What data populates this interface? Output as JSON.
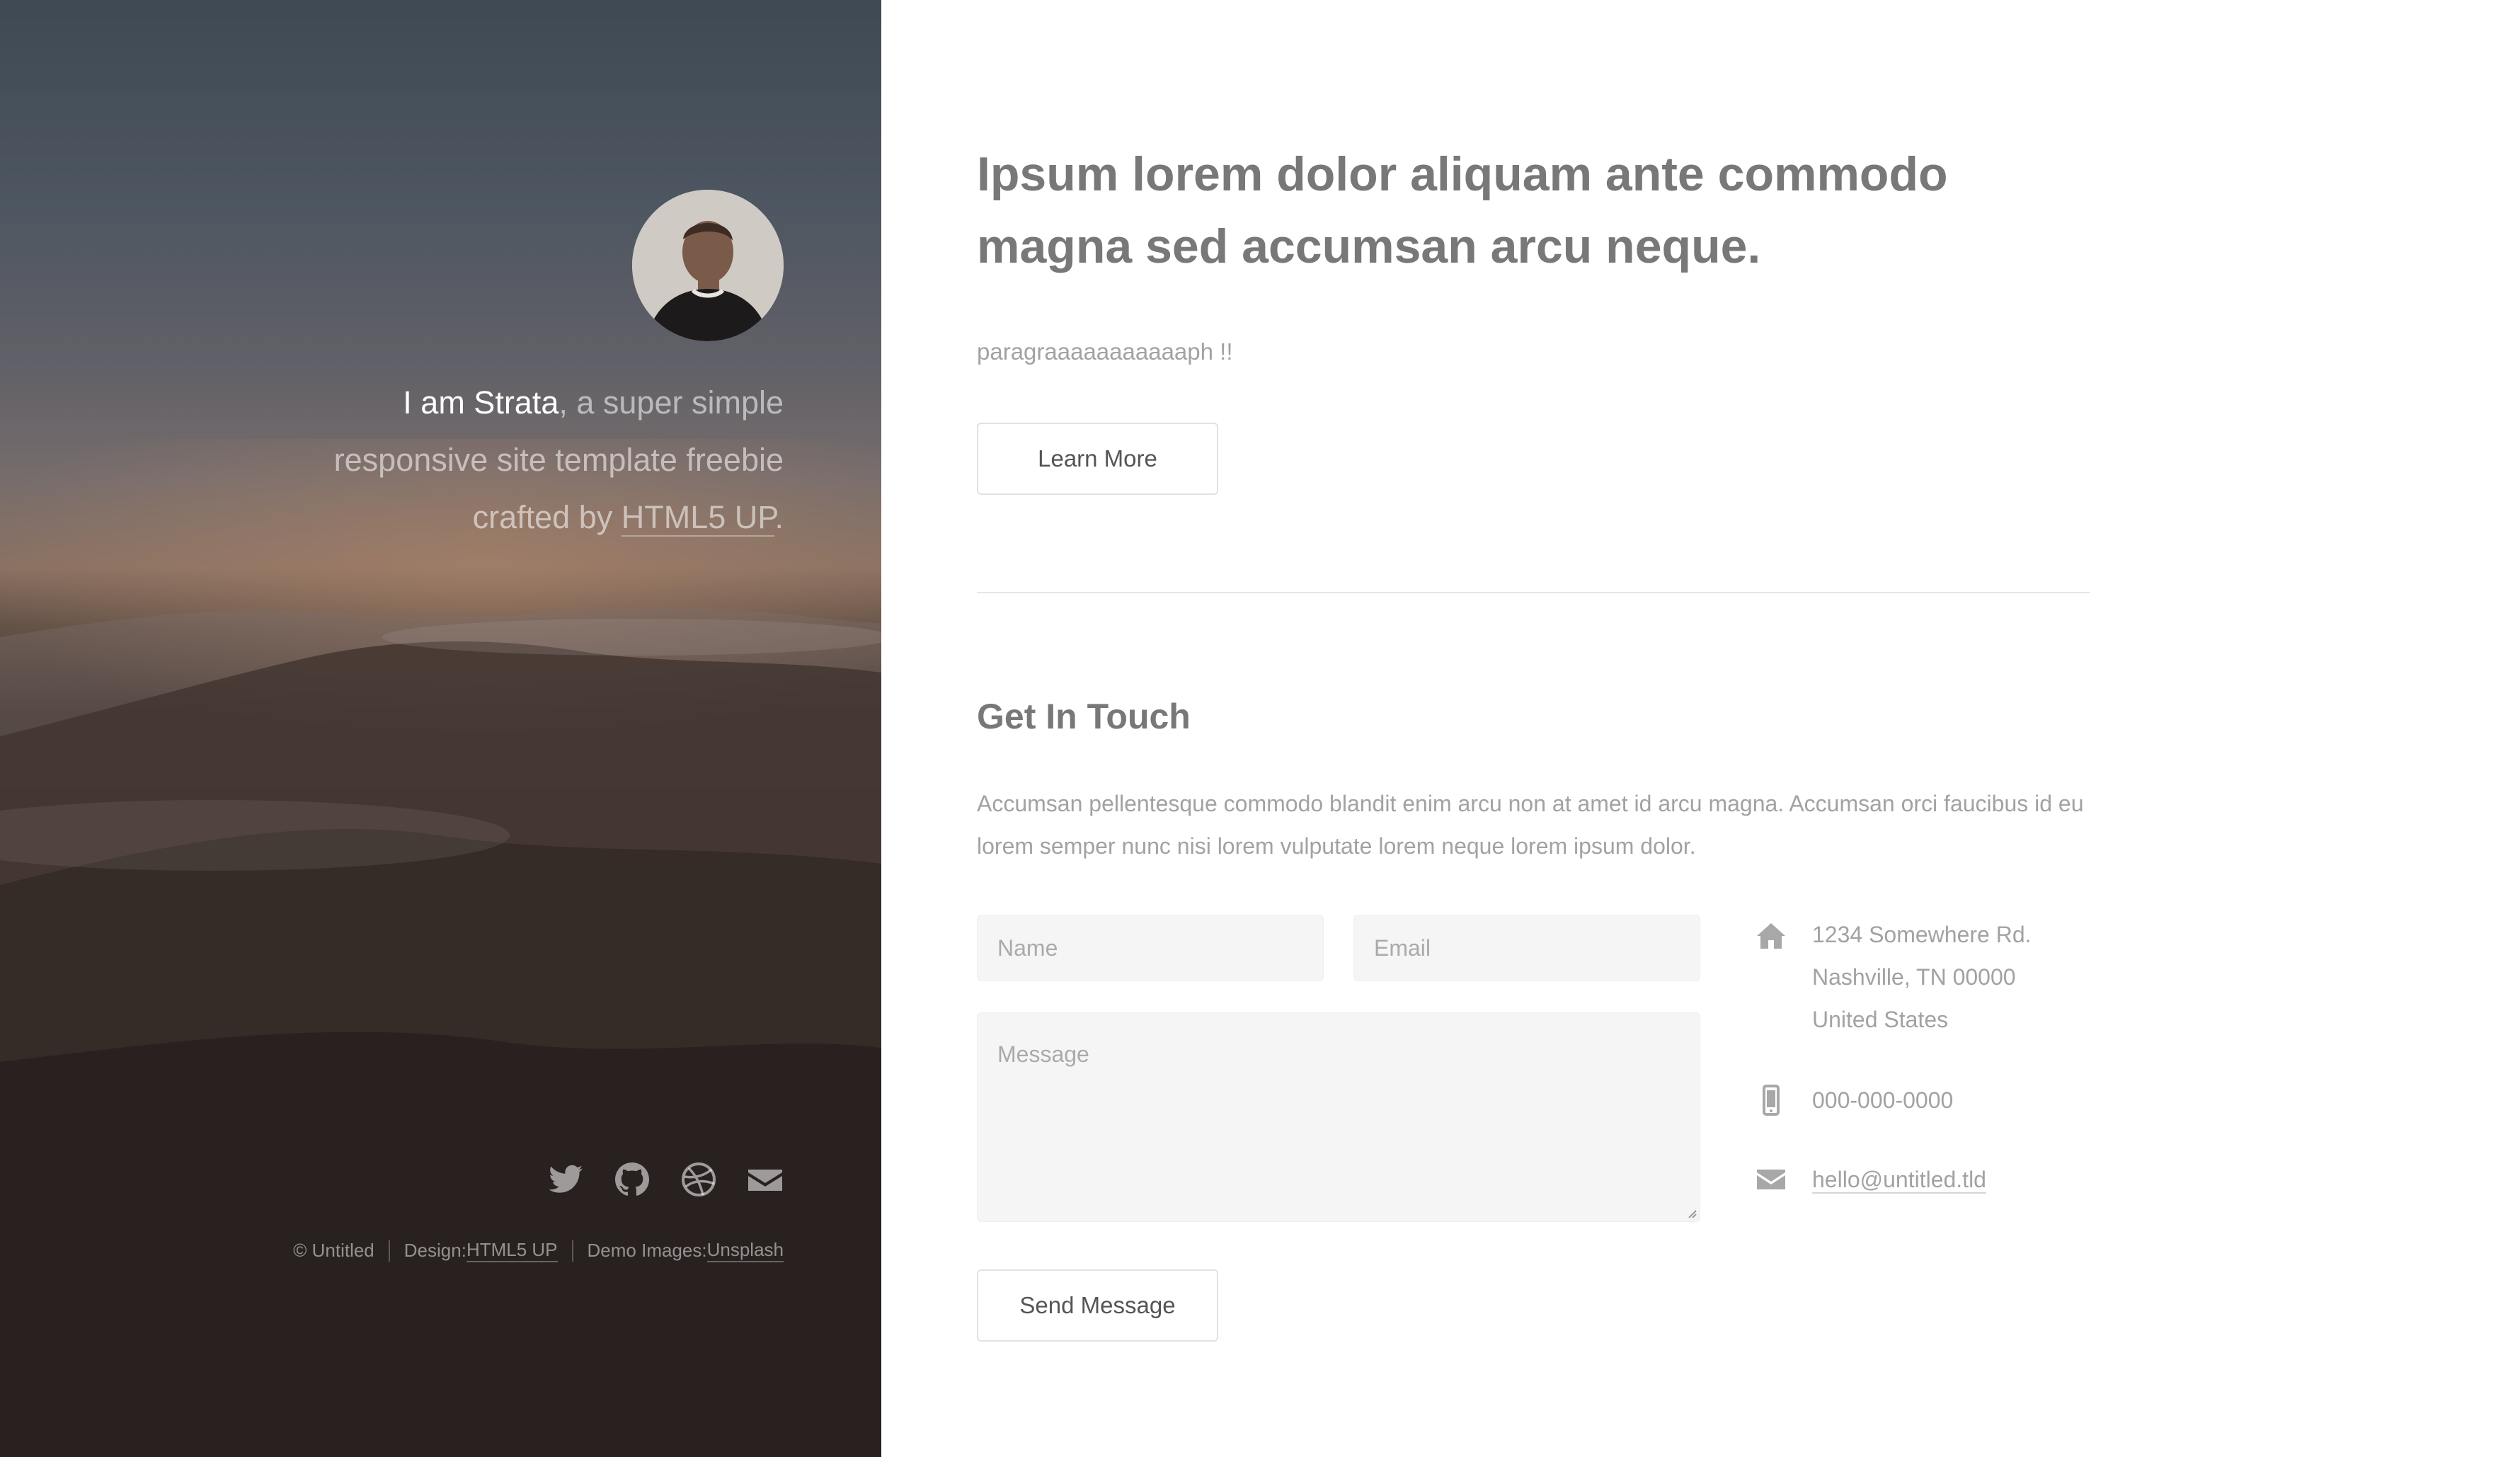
{
  "sidebar": {
    "intro": {
      "strong": "I am Strata",
      "rest_1": ", a super simple",
      "rest_2": "responsive site template freebie",
      "rest_3": "crafted by ",
      "link": "HTML5 UP",
      "period": "."
    },
    "social": [
      {
        "icon": "twitter-icon"
      },
      {
        "icon": "github-icon"
      },
      {
        "icon": "dribbble-icon"
      },
      {
        "icon": "envelope-icon"
      }
    ],
    "copyright": {
      "owner": "© Untitled",
      "design_label": "Design: ",
      "design_link": "HTML5 UP",
      "images_label": "Demo Images: ",
      "images_link": "Unsplash"
    }
  },
  "main": {
    "headline_1": "Ipsum lorem dolor aliquam ante commodo",
    "headline_2": "magna sed accumsan arcu neque.",
    "paragraph": "paragraaaaaaaaaaaph !!",
    "learn_more": "Learn More",
    "contact": {
      "title": "Get In Touch",
      "description_1": "Accumsan pellentesque commodo blandit enim arcu non at amet id arcu magna. Accumsan orci faucibus id eu",
      "description_2": "lorem semper nunc nisi lorem vulputate lorem neque lorem ipsum dolor.",
      "form": {
        "name_placeholder": "Name",
        "email_placeholder": "Email",
        "message_placeholder": "Message",
        "submit_label": "Send Message"
      },
      "info": {
        "address_1": "1234 Somewhere Rd.",
        "address_2": "Nashville, TN 00000",
        "address_3": "United States",
        "phone": "000-000-0000",
        "email": "hello@untitled.tld"
      }
    }
  },
  "colors": {
    "sidebar_text": "#ffffff",
    "body_text": "#a2a2a2",
    "heading_text": "#787878",
    "field_bg": "#f5f5f5"
  }
}
